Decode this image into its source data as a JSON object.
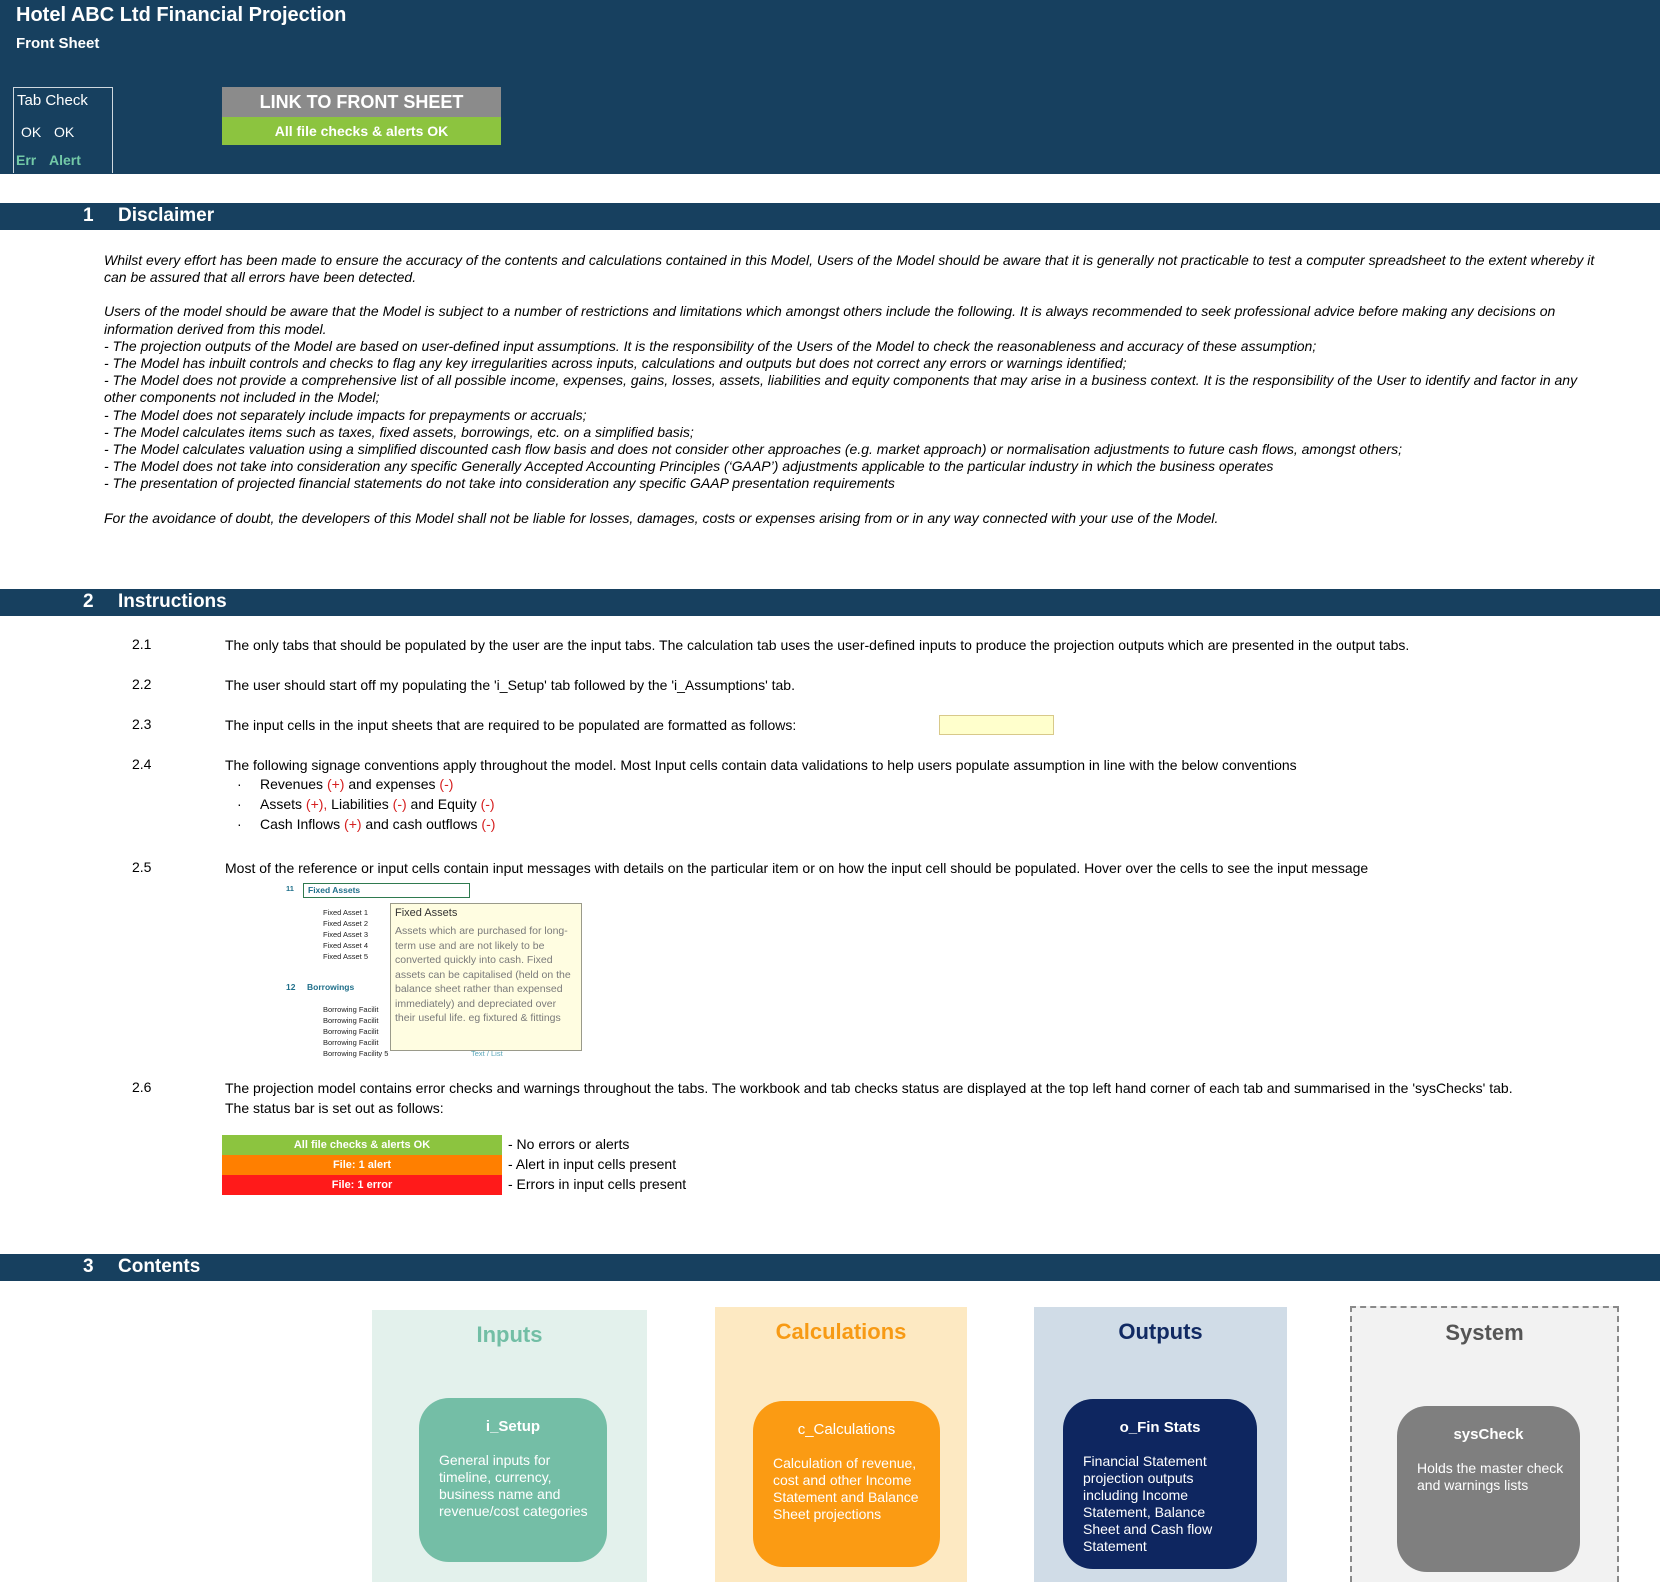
{
  "header": {
    "title": "Hotel ABC Ltd Financial Projection",
    "sheet": "Front Sheet",
    "tab_check": {
      "label": "Tab Check",
      "ok1": "OK",
      "ok2": "OK",
      "err": "Err",
      "alert": "Alert"
    },
    "link_button": "LINK TO FRONT SHEET",
    "status_ok": "All file checks & alerts OK"
  },
  "sections": {
    "disclaimer": {
      "num": "1",
      "title": "Disclaimer"
    },
    "instructions": {
      "num": "2",
      "title": "Instructions"
    },
    "contents": {
      "num": "3",
      "title": "Contents"
    }
  },
  "disclaimer": {
    "p1": "Whilst every effort has been made to ensure the accuracy of the contents and calculations contained in this Model, Users of the Model should be aware that it is generally not practicable to test a computer spreadsheet to the extent whereby it can be assured that all errors have been detected.",
    "p2": "Users of the model should be aware that the Model is subject to a number of restrictions and limitations which amongst others include the following. It is always recommended to seek professional advice before making any decisions on information derived from this model.",
    "items": [
      "- The projection outputs of the Model are based on user-defined input assumptions. It is the responsibility of the Users of the Model to check the reasonableness and accuracy of these assumption;",
      "- The Model has inbuilt controls and checks to flag any key irregularities across inputs, calculations and outputs but does not correct any errors or warnings identified;",
      "- The Model does not provide a comprehensive list of all possible income, expenses, gains, losses, assets, liabilities and equity components that may arise in a business context. It is the responsibility of the User to identify and factor in any other components not included in the Model;",
      "- The Model does not separately include impacts for prepayments or accruals;",
      "- The Model calculates items such as taxes, fixed assets, borrowings, etc. on a simplified basis;",
      "- The Model calculates valuation using a simplified discounted cash flow basis and does not consider other approaches (e.g. market approach) or normalisation adjustments to future cash flows, amongst others;",
      "- The Model does not take into consideration any specific Generally Accepted Accounting Principles (‘GAAP’) adjustments applicable to the particular industry in which the business operates",
      "- The presentation of projected financial statements do not take into consideration any specific GAAP presentation requirements"
    ],
    "p3": "For the avoidance of doubt, the developers of this Model shall not be liable for losses, damages, costs or expenses arising from or in any way connected with your use of the Model."
  },
  "instructions": {
    "i1": {
      "num": "2.1",
      "text": "The only tabs that should be populated by the user are the input tabs. The calculation tab uses the user-defined inputs to produce the projection outputs which are presented in the output tabs."
    },
    "i2": {
      "num": "2.2",
      "text": "The user should start off my populating the 'i_Setup' tab followed by the 'i_Assumptions' tab."
    },
    "i3": {
      "num": "2.3",
      "text": "The input cells in the input sheets that are required to be populated are formatted as follows:"
    },
    "i4": {
      "num": "2.4",
      "text": "The following signage conventions apply throughout the model. Most Input cells contain data validations to help users populate assumption in line with the below conventions"
    },
    "bullets": {
      "b1": {
        "a": "Revenues ",
        "s1": "(+)",
        "b": " and expenses ",
        "s2": "(-)"
      },
      "b2": {
        "a": "Assets ",
        "s1": "(+),",
        "b": " Liabilities ",
        "s2": "(-)",
        "c": " and Equity ",
        "s3": "(-)"
      },
      "b3": {
        "a": "Cash Inflows ",
        "s1": "(+)",
        "b": " and cash outflows ",
        "s2": "(-)"
      }
    },
    "i5": {
      "num": "2.5",
      "text": "Most of the reference or input cells contain input messages with details on the particular item or on how the input cell should be populated. Hover over the cells to see the input message"
    },
    "i6": {
      "num": "2.6",
      "text": "The projection model contains error checks and warnings throughout the tabs. The workbook and tab checks status are displayed at the top left hand corner of each tab and summarised in the 'sysChecks' tab.",
      "text2": "The status bar is set out as follows:"
    },
    "example": {
      "row11_num": "11",
      "row11_label": "Fixed Assets",
      "fixed_assets": [
        "Fixed Asset 1",
        "Fixed Asset 2",
        "Fixed Asset 3",
        "Fixed Asset 4",
        "Fixed Asset 5"
      ],
      "row12_num": "12",
      "row12_label": "Borrowings",
      "borrowings": [
        "Borrowing Facilit",
        "Borrowing Facilit",
        "Borrowing Facilit",
        "Borrowing Facilit",
        "Borrowing Facility 5"
      ],
      "text_list": "Text / List",
      "tooltip_title": "Fixed Assets",
      "tooltip_body": "Assets which are purchased for long-term use and are not likely to be converted quickly into cash. Fixed assets can be capitalised (held on the balance sheet rather than expensed immediately) and depreciated over their useful life. eg fixtured & fittings"
    },
    "legend": [
      {
        "bar": "All file checks & alerts OK",
        "text": "- No errors or alerts",
        "color": "#8cc43f"
      },
      {
        "bar": "File: 1 alert",
        "text": "- Alert in input cells present",
        "color": "#ff7f00"
      },
      {
        "bar": "File: 1 error",
        "text": "- Errors in input cells present",
        "color": "#ff1a1a"
      }
    ]
  },
  "contents": {
    "inputs": {
      "title": "Inputs",
      "card_title": "i_Setup",
      "card_desc": "General inputs for timeline, currency, business name and revenue/cost categories",
      "bg": "#e3f1ec",
      "title_color": "#72bea5",
      "card_color": "#74bea6"
    },
    "calculations": {
      "title": "Calculations",
      "card_title": "c_Calculations",
      "card_desc": "Calculation of revenue, cost and other Income Statement and Balance Sheet projections",
      "bg": "#fde9c2",
      "title_color": "#f79a14",
      "card_color": "#fb9b13"
    },
    "outputs": {
      "title": "Outputs",
      "card_title": "o_Fin Stats",
      "card_desc": "Financial Statement projection outputs including Income Statement, Balance Sheet and Cash flow Statement",
      "bg": "#d0dce7",
      "title_color": "#112a63",
      "card_color": "#0e2660"
    },
    "system": {
      "title": "System",
      "card_title": "sysCheck",
      "card_desc": "Holds the master check and warnings lists",
      "bg": "#f2f2f2",
      "title_color": "#555555",
      "card_color": "#7f7f7f"
    }
  }
}
